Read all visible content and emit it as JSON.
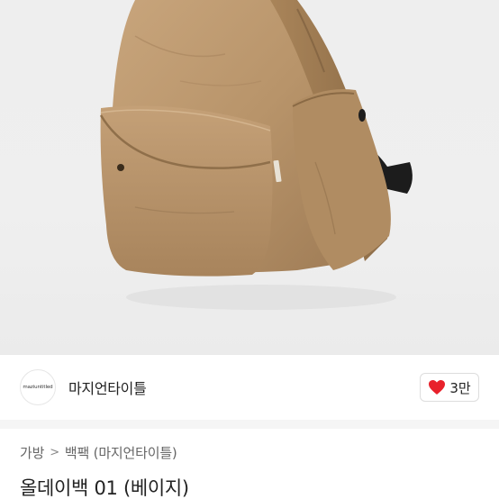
{
  "product_image": {
    "subject": "beige nylon backpack"
  },
  "brand": {
    "logo_text": "maziuntitled",
    "name": "마지언타이틀"
  },
  "like": {
    "icon": "heart-icon",
    "count": "3만",
    "color": "#e8212b"
  },
  "breadcrumb": {
    "category": "가방",
    "separator": ">",
    "subcategory": "백팩 (마지언타이틀)"
  },
  "product": {
    "title": "올데이백 01 (베이지)"
  }
}
